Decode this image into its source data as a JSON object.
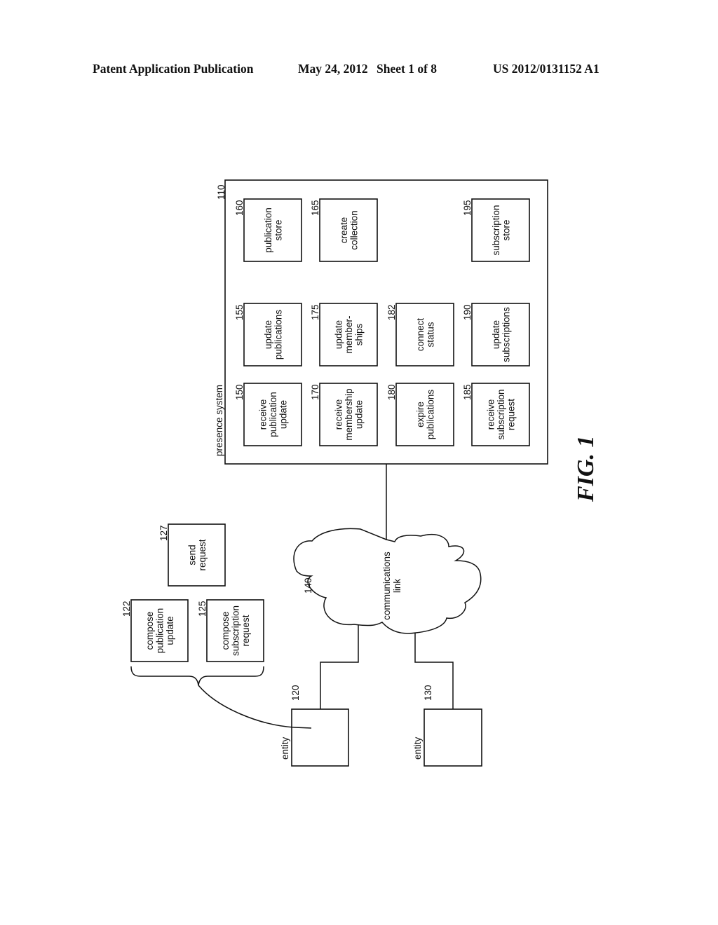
{
  "header": {
    "publication_type": "Patent Application Publication",
    "date": "May 24, 2012",
    "sheet": "Sheet 1 of 8",
    "patent_number": "US 2012/0131152 A1"
  },
  "figure_label": "FIG. 1",
  "presence_system": {
    "ref": "110",
    "label": "presence system",
    "components": [
      {
        "ref": "160",
        "lines": [
          "publication",
          "store"
        ]
      },
      {
        "ref": "165",
        "lines": [
          "create",
          "collection"
        ]
      },
      {
        "ref": "195",
        "lines": [
          "subscription",
          "store"
        ]
      },
      {
        "ref": "155",
        "lines": [
          "update",
          "publications"
        ]
      },
      {
        "ref": "175",
        "lines": [
          "update",
          "member-",
          "ships"
        ]
      },
      {
        "ref": "182",
        "lines": [
          "connect",
          "status"
        ]
      },
      {
        "ref": "190",
        "lines": [
          "update",
          "subscriptions"
        ]
      },
      {
        "ref": "150",
        "lines": [
          "receive",
          "publication",
          "update"
        ]
      },
      {
        "ref": "170",
        "lines": [
          "receive",
          "membership",
          "update"
        ]
      },
      {
        "ref": "180",
        "lines": [
          "expire",
          "publications"
        ]
      },
      {
        "ref": "185",
        "lines": [
          "receive",
          "subscription",
          "request"
        ]
      }
    ]
  },
  "communications_link": {
    "ref": "140",
    "lines": [
      "communications",
      "link"
    ]
  },
  "entities": [
    {
      "ref": "120",
      "label": "entity"
    },
    {
      "ref": "130",
      "label": "entity"
    }
  ],
  "entity_actions": [
    {
      "ref": "122",
      "lines": [
        "compose",
        "publication",
        "update"
      ]
    },
    {
      "ref": "125",
      "lines": [
        "compose",
        "subscription",
        "request"
      ]
    },
    {
      "ref": "127",
      "lines": [
        "send",
        "request"
      ]
    }
  ]
}
